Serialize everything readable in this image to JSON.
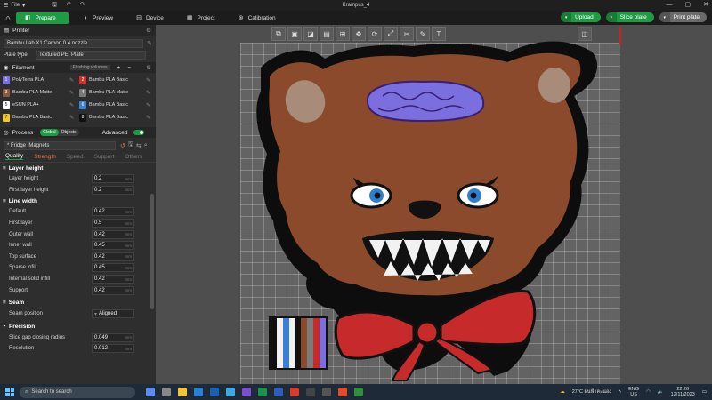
{
  "titlebar": {
    "file_menu": "File",
    "window_title": "Krampus_4",
    "minimize": "—",
    "maximize": "▢",
    "close": "✕"
  },
  "nav": {
    "tabs": [
      {
        "label": "Prepare",
        "icon": "prepare-icon",
        "active": true
      },
      {
        "label": "Preview",
        "icon": "preview-icon",
        "active": false
      },
      {
        "label": "Device",
        "icon": "device-icon",
        "active": false
      },
      {
        "label": "Project",
        "icon": "project-icon",
        "active": false
      },
      {
        "label": "Calibration",
        "icon": "calibration-icon",
        "active": false
      }
    ],
    "upload_label": "Upload",
    "slice_label": "Slice plate",
    "print_label": "Print plate"
  },
  "printer": {
    "header": "Printer",
    "name": "Bambu Lab X1 Carbon 0.4 nozzle",
    "plate_type_label": "Plate type",
    "plate_type": "Textured PEI Plate"
  },
  "filament": {
    "header": "Filament",
    "flushing_label": "Flushing volumes",
    "items": [
      {
        "num": "1",
        "name": "PolyTerra PLA",
        "color": "#7b6fe0"
      },
      {
        "num": "2",
        "name": "Bambu PLA Basic",
        "color": "#d12e2e"
      },
      {
        "num": "3",
        "name": "Bambu PLA Matte",
        "color": "#8b5a3c"
      },
      {
        "num": "4",
        "name": "Bambu PLA Matte",
        "color": "#7a7a7a"
      },
      {
        "num": "5",
        "name": "eSUN PLA+",
        "color": "#ffffff"
      },
      {
        "num": "6",
        "name": "Bambu PLA Basic",
        "color": "#3a7fd8"
      },
      {
        "num": "7",
        "name": "Bambu PLA Basic",
        "color": "#f0c92a"
      },
      {
        "num": "8",
        "name": "Bambu PLA Basic",
        "color": "#111111"
      }
    ]
  },
  "process": {
    "header": "Process",
    "global_label": "Global",
    "objects_label": "Objects",
    "advanced_label": "Advanced",
    "preset": "* Fridge_Magnets",
    "tabs": [
      {
        "label": "Quality",
        "state": "active"
      },
      {
        "label": "Strength",
        "state": "warn"
      },
      {
        "label": "Speed",
        "state": "idle"
      },
      {
        "label": "Support",
        "state": "idle"
      },
      {
        "label": "Others",
        "state": "idle"
      }
    ]
  },
  "groups": {
    "layer_height": {
      "title": "Layer height",
      "params": [
        {
          "label": "Layer height",
          "value": "0.2",
          "unit": "mm"
        },
        {
          "label": "First layer height",
          "value": "0.2",
          "unit": "mm"
        }
      ]
    },
    "line_width": {
      "title": "Line width",
      "params": [
        {
          "label": "Default",
          "value": "0.42",
          "unit": "mm"
        },
        {
          "label": "First layer",
          "value": "0.5",
          "unit": "mm"
        },
        {
          "label": "Outer wall",
          "value": "0.42",
          "unit": "mm"
        },
        {
          "label": "Inner wall",
          "value": "0.45",
          "unit": "mm"
        },
        {
          "label": "Top surface",
          "value": "0.42",
          "unit": "mm"
        },
        {
          "label": "Sparse infill",
          "value": "0.45",
          "unit": "mm"
        },
        {
          "label": "Internal solid infill",
          "value": "0.42",
          "unit": "mm"
        },
        {
          "label": "Support",
          "value": "0.42",
          "unit": "mm"
        }
      ]
    },
    "seam": {
      "title": "Seam",
      "params": [
        {
          "label": "Seam position",
          "value": "Aligned"
        }
      ]
    },
    "precision": {
      "title": "Precision",
      "params": [
        {
          "label": "Slice gap closing radius",
          "value": "0.049",
          "unit": "mm"
        },
        {
          "label": "Resolution",
          "value": "0.012",
          "unit": "mm"
        }
      ]
    }
  },
  "taskbar": {
    "search_placeholder": "Search to search",
    "weather": "27°C ฝนฟ้าคะนอง",
    "lang_top": "ENG",
    "lang_bottom": "US",
    "time": "22:26",
    "date": "12/11/2023"
  },
  "colors": {
    "accent": "#1f9b45",
    "bear_body": "#8b4a2b",
    "bow": "#c62a2a",
    "brain": "#7b6fe0",
    "eyes": "#2f7fd0"
  }
}
